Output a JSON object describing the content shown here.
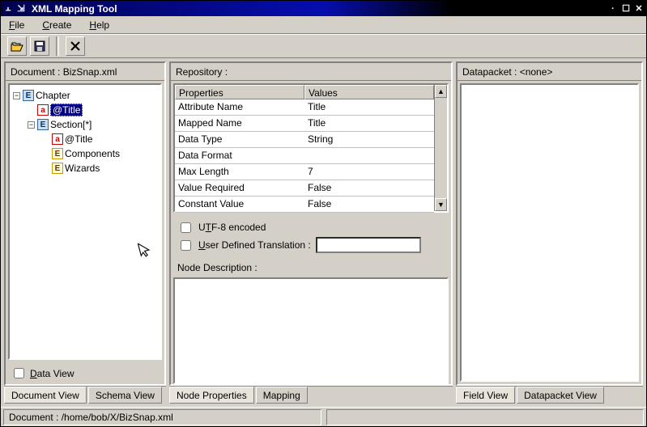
{
  "title": "XML Mapping Tool",
  "menu": {
    "file": "File",
    "create": "Create",
    "help": "Help"
  },
  "toolbar": {
    "open": "📂",
    "save": "💾",
    "close": "✕"
  },
  "leftPanel": {
    "title": "Document : BizSnap.xml",
    "tree": {
      "n0": "Chapter",
      "n1": "@Title",
      "n2": "Section[*]",
      "n3": "@Title",
      "n4": "Components",
      "n5": "Wizards"
    },
    "dataview": "Data View",
    "tabs": {
      "doc": "Document View",
      "schema": "Schema View"
    }
  },
  "midPanel": {
    "title": "Repository :",
    "headers": {
      "prop": "Properties",
      "val": "Values"
    },
    "rows": {
      "r0p": "Attribute Name",
      "r0v": "Title",
      "r1p": "Mapped Name",
      "r1v": "Title",
      "r2p": "Data Type",
      "r2v": "String",
      "r3p": "Data Format",
      "r3v": "",
      "r4p": "Max Length",
      "r4v": "7",
      "r5p": "Value Required",
      "r5v": "False",
      "r6p": "Constant Value",
      "r6v": "False"
    },
    "utf8": "UTF-8 encoded",
    "userdef": "User Defined Translation :",
    "nodedesc": "Node Description :",
    "tabs": {
      "np": "Node Properties",
      "map": "Mapping"
    }
  },
  "rightPanel": {
    "title": "Datapacket : <none>",
    "tabs": {
      "fv": "Field View",
      "dpv": "Datapacket View"
    }
  },
  "status": "Document : /home/bob/X/BizSnap.xml"
}
